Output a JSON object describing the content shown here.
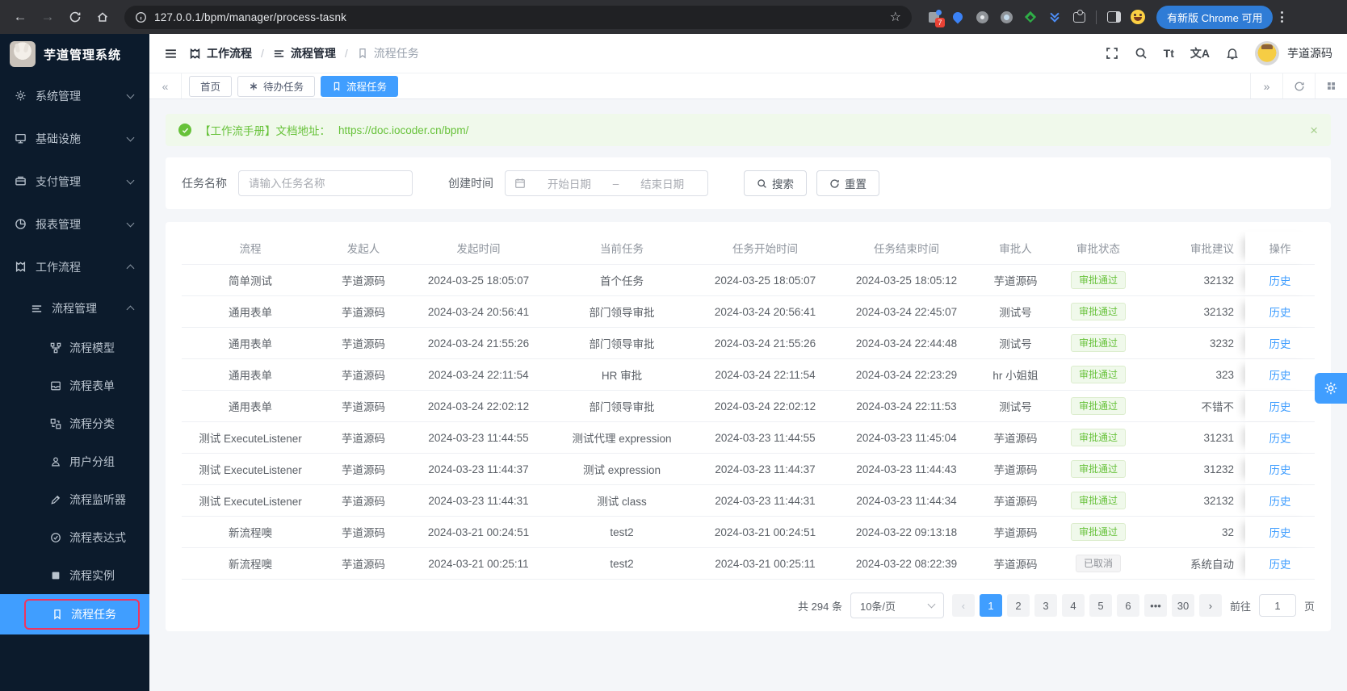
{
  "colors": {
    "accent": "#409eff",
    "success": "#67c23a",
    "sidebar_bg": "#0c1b2c",
    "highlight_red": "#f0355e"
  },
  "browser": {
    "url": "127.0.0.1/bpm/manager/process-tasnk",
    "extension_badge": "7",
    "update_button": "有新版 Chrome 可用"
  },
  "sidebar": {
    "logo_title": "芋道管理系统",
    "menu": [
      {
        "label": "系统管理"
      },
      {
        "label": "基础设施"
      },
      {
        "label": "支付管理"
      },
      {
        "label": "报表管理"
      },
      {
        "label": "工作流程"
      }
    ],
    "submenu": {
      "label": "流程管理",
      "children": [
        "流程模型",
        "流程表单",
        "流程分类",
        "用户分组",
        "流程监听器",
        "流程表达式",
        "流程实例",
        "流程任务"
      ]
    }
  },
  "header": {
    "breadcrumb": [
      "工作流程",
      "流程管理",
      "流程任务"
    ],
    "fontsize_icon": "Tt",
    "locale_icon": "文A",
    "username": "芋道源码"
  },
  "tabs": [
    {
      "label": "首页"
    },
    {
      "label": "待办任务"
    },
    {
      "label": "流程任务"
    }
  ],
  "alert": {
    "text": "【工作流手册】文档地址：",
    "link": "https://doc.iocoder.cn/bpm/",
    "close": "×"
  },
  "filters": {
    "task_name_label": "任务名称",
    "task_name_placeholder": "请输入任务名称",
    "create_time_label": "创建时间",
    "start_date_placeholder": "开始日期",
    "range_separator": "–",
    "end_date_placeholder": "结束日期",
    "search_label": "搜索",
    "reset_label": "重置"
  },
  "table": {
    "columns": [
      "流程",
      "发起人",
      "发起时间",
      "当前任务",
      "任务开始时间",
      "任务结束时间",
      "审批人",
      "审批状态",
      "审批建议",
      "操作"
    ],
    "history_label": "历史",
    "rows": [
      {
        "process": "简单测试",
        "starter": "芋道源码",
        "start_time": "2024-03-25 18:05:07",
        "current_task": "首个任务",
        "task_start_time": "2024-03-25 18:05:07",
        "task_end_time": "2024-03-25 18:05:12",
        "approver": "芋道源码",
        "status": "审批通过",
        "status_type": "success",
        "comment": "32132"
      },
      {
        "process": "通用表单",
        "starter": "芋道源码",
        "start_time": "2024-03-24 20:56:41",
        "current_task": "部门领导审批",
        "task_start_time": "2024-03-24 20:56:41",
        "task_end_time": "2024-03-24 22:45:07",
        "approver": "测试号",
        "status": "审批通过",
        "status_type": "success",
        "comment": "32132"
      },
      {
        "process": "通用表单",
        "starter": "芋道源码",
        "start_time": "2024-03-24 21:55:26",
        "current_task": "部门领导审批",
        "task_start_time": "2024-03-24 21:55:26",
        "task_end_time": "2024-03-24 22:44:48",
        "approver": "测试号",
        "status": "审批通过",
        "status_type": "success",
        "comment": "3232"
      },
      {
        "process": "通用表单",
        "starter": "芋道源码",
        "start_time": "2024-03-24 22:11:54",
        "current_task": "HR 审批",
        "task_start_time": "2024-03-24 22:11:54",
        "task_end_time": "2024-03-24 22:23:29",
        "approver": "hr 小姐姐",
        "status": "审批通过",
        "status_type": "success",
        "comment": "323"
      },
      {
        "process": "通用表单",
        "starter": "芋道源码",
        "start_time": "2024-03-24 22:02:12",
        "current_task": "部门领导审批",
        "task_start_time": "2024-03-24 22:02:12",
        "task_end_time": "2024-03-24 22:11:53",
        "approver": "测试号",
        "status": "审批通过",
        "status_type": "success",
        "comment": "不错不"
      },
      {
        "process": "测试 ExecuteListener",
        "starter": "芋道源码",
        "start_time": "2024-03-23 11:44:55",
        "current_task": "测试代理 expression",
        "task_start_time": "2024-03-23 11:44:55",
        "task_end_time": "2024-03-23 11:45:04",
        "approver": "芋道源码",
        "status": "审批通过",
        "status_type": "success",
        "comment": "31231"
      },
      {
        "process": "测试 ExecuteListener",
        "starter": "芋道源码",
        "start_time": "2024-03-23 11:44:37",
        "current_task": "测试 expression",
        "task_start_time": "2024-03-23 11:44:37",
        "task_end_time": "2024-03-23 11:44:43",
        "approver": "芋道源码",
        "status": "审批通过",
        "status_type": "success",
        "comment": "31232"
      },
      {
        "process": "测试 ExecuteListener",
        "starter": "芋道源码",
        "start_time": "2024-03-23 11:44:31",
        "current_task": "测试 class",
        "task_start_time": "2024-03-23 11:44:31",
        "task_end_time": "2024-03-23 11:44:34",
        "approver": "芋道源码",
        "status": "审批通过",
        "status_type": "success",
        "comment": "32132"
      },
      {
        "process": "新流程噢",
        "starter": "芋道源码",
        "start_time": "2024-03-21 00:24:51",
        "current_task": "test2",
        "task_start_time": "2024-03-21 00:24:51",
        "task_end_time": "2024-03-22 09:13:18",
        "approver": "芋道源码",
        "status": "审批通过",
        "status_type": "success",
        "comment": "32"
      },
      {
        "process": "新流程噢",
        "starter": "芋道源码",
        "start_time": "2024-03-21 00:25:11",
        "current_task": "test2",
        "task_start_time": "2024-03-21 00:25:11",
        "task_end_time": "2024-03-22 08:22:39",
        "approver": "芋道源码",
        "status": "已取消",
        "status_type": "info",
        "comment": "系统自动"
      }
    ]
  },
  "pagination": {
    "total": "共 294 条",
    "page_size": "10条/页",
    "prev": "‹",
    "next": "›",
    "pages": [
      "1",
      "2",
      "3",
      "4",
      "5",
      "6"
    ],
    "active_page": "1",
    "ellipsis": "•••",
    "last_page": "30",
    "goto_label": "前往",
    "goto_value": "1",
    "unit_label": "页"
  }
}
